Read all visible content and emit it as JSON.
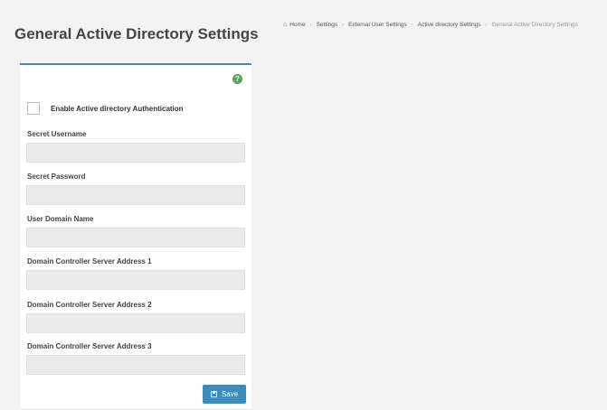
{
  "header": {
    "title": "General Active Directory Settings"
  },
  "breadcrumb": {
    "items": [
      "Home",
      "Settings",
      "External User Settings",
      "Active directory Settings"
    ],
    "current": "General Active Directory Settings"
  },
  "form": {
    "help_icon": "question-circle-icon",
    "enable_checkbox": {
      "label": "Enable Active directory Authentication",
      "checked": false
    },
    "fields": [
      {
        "label": "Secret Username",
        "value": "",
        "placeholder": ""
      },
      {
        "label": "Secret Password",
        "value": "",
        "placeholder": ""
      },
      {
        "label": "User Domain Name",
        "value": "",
        "placeholder": ""
      },
      {
        "label": "Domain Controller Server Address 1",
        "value": "",
        "placeholder": ""
      },
      {
        "label": "Domain Controller Server Address 2",
        "value": "",
        "placeholder": ""
      },
      {
        "label": "Domain Controller Server Address 3",
        "value": "",
        "placeholder": ""
      }
    ],
    "save_label": "Save",
    "save_icon": "floppy-disk-icon"
  },
  "colors": {
    "accent": "#3c8dbc",
    "help": "#5ba35b",
    "background": "#f3f3f3",
    "input_disabled": "#ebebeb"
  }
}
